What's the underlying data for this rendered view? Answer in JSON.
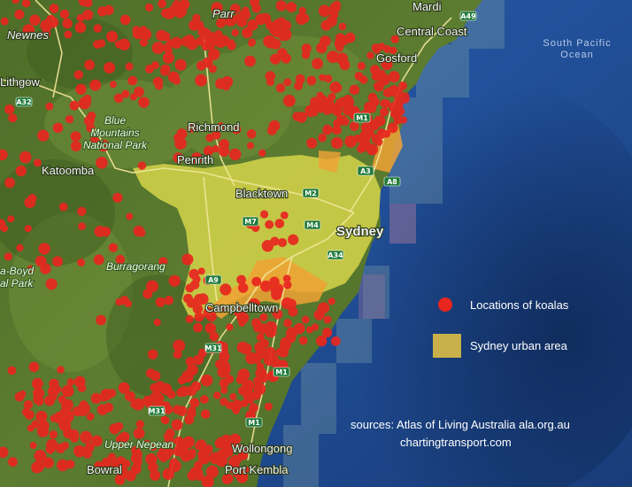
{
  "places": {
    "newnes": "Newnes",
    "lithgow": "Lithgow",
    "parr": "Parr",
    "mardi": "Mardi",
    "central_coast": "Central Coast",
    "gosford": "Gosford",
    "blue_mountains": "Blue\nMountains\nNational Park",
    "richmond": "Richmond",
    "katoomba": "Katoomba",
    "penrith": "Penrith",
    "blacktown": "Blacktown",
    "sydney": "Sydney",
    "burragorang": "Burragorang",
    "nattai": "a-Boyd\nal Park",
    "campbelltown": "Campbelltown",
    "upper_nepean": "Upper Nepean",
    "wollongong": "Wollongong",
    "port_kembla": "Port Kembla",
    "bowral": "Bowral",
    "ocean": "South Pacific\nOcean"
  },
  "roads": [
    "A49",
    "A32",
    "M1",
    "A3",
    "M2",
    "M7",
    "M4",
    "A34",
    "A9",
    "M31",
    "M1",
    "M31",
    "M1",
    "A8"
  ],
  "legend": {
    "koalas_label": "Locations of koalas",
    "urban_label": "Sydney urban area",
    "koala_color": "#e8261f",
    "urban_color": "#c8b04a"
  },
  "sources": {
    "line1": "sources: Atlas of Living Australia ala.org.au",
    "line2": "chartingtransport.com"
  },
  "colors": {
    "land": "#5a7a2e",
    "ocean": "#1f4f9a",
    "urban": "#d8d24a"
  }
}
